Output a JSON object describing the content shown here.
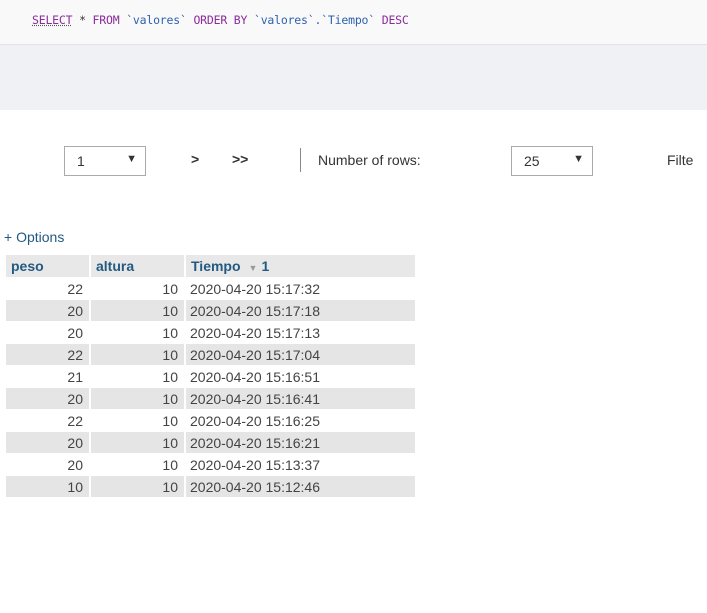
{
  "query": {
    "select": "SELECT",
    "star": "*",
    "from": "FROM",
    "table": "`valores`",
    "order_by": "ORDER BY",
    "column": "`valores`.`Tiempo`",
    "desc": "DESC"
  },
  "nav": {
    "page_value": "1",
    "next_label": ">",
    "last_label": ">>",
    "rows_label": "Number of rows:",
    "rows_value": "25",
    "filter_label": "Filte"
  },
  "options_label": "+ Options",
  "table": {
    "headers": [
      "peso",
      "altura",
      "Tiempo"
    ],
    "sort_index": "1",
    "rows": [
      [
        "22",
        "10",
        "2020-04-20 15:17:32"
      ],
      [
        "20",
        "10",
        "2020-04-20 15:17:18"
      ],
      [
        "20",
        "10",
        "2020-04-20 15:17:13"
      ],
      [
        "22",
        "10",
        "2020-04-20 15:17:04"
      ],
      [
        "21",
        "10",
        "2020-04-20 15:16:51"
      ],
      [
        "20",
        "10",
        "2020-04-20 15:16:41"
      ],
      [
        "22",
        "10",
        "2020-04-20 15:16:25"
      ],
      [
        "20",
        "10",
        "2020-04-20 15:16:21"
      ],
      [
        "20",
        "10",
        "2020-04-20 15:13:37"
      ],
      [
        "10",
        "10",
        "2020-04-20 15:12:46"
      ]
    ]
  }
}
